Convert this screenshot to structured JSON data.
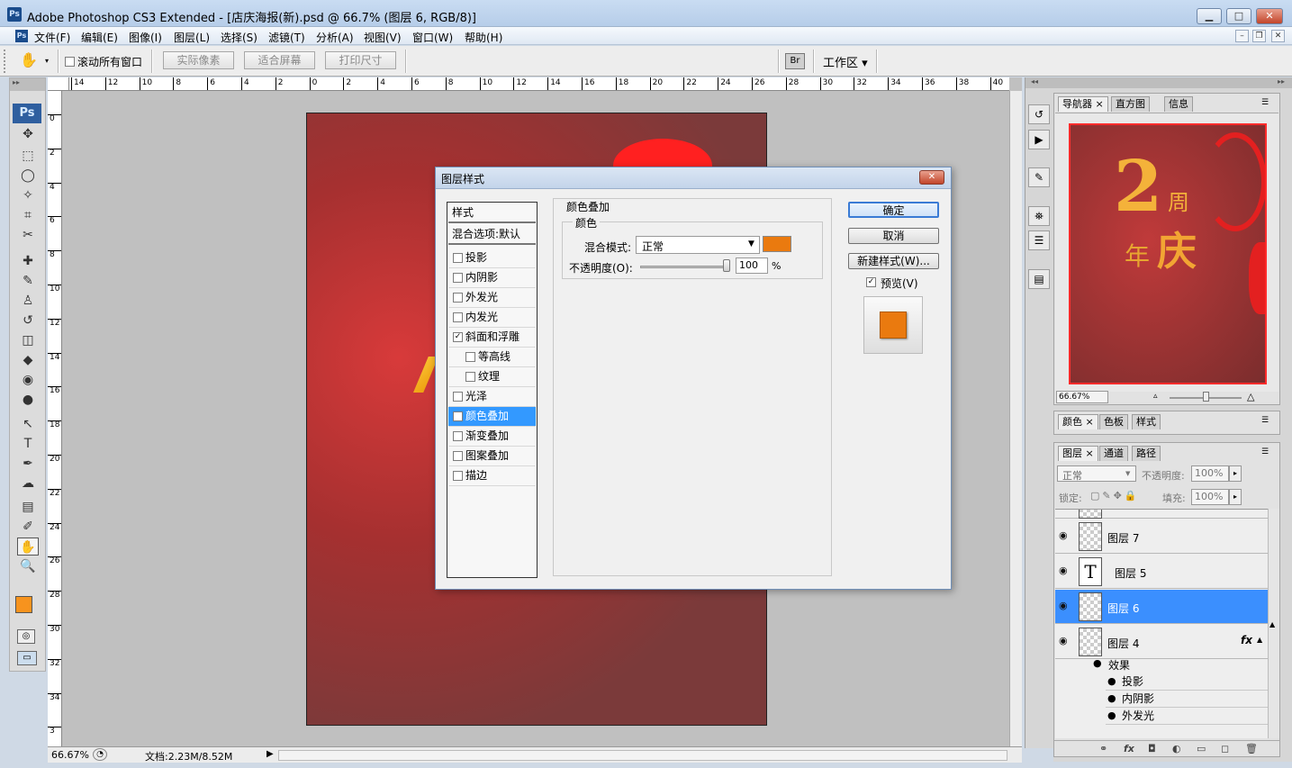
{
  "window": {
    "app_icon": "Ps",
    "title": "Adobe Photoshop CS3 Extended - [店庆海报(新).psd @ 66.7% (图层 6, RGB/8)]",
    "controls": {
      "minimize": "▁",
      "maximize": "□",
      "close": "✕"
    }
  },
  "menubar": {
    "items": [
      "文件(F)",
      "编辑(E)",
      "图像(I)",
      "图层(L)",
      "选择(S)",
      "滤镜(T)",
      "分析(A)",
      "视图(V)",
      "窗口(W)",
      "帮助(H)"
    ],
    "mdi": {
      "minimize": "–",
      "restore": "❐",
      "close": "✕"
    }
  },
  "options": {
    "tool_icon": "✋",
    "scroll_all_label": "滚动所有窗口",
    "actual_pixels": "实际像素",
    "fit_screen": "适合屏幕",
    "print_size": "打印尺寸",
    "workspace": "工作区 ▾"
  },
  "ruler": {
    "top_ticks": [
      "14",
      "12",
      "10",
      "8",
      "6",
      "4",
      "2",
      "0",
      "2",
      "4",
      "6",
      "8",
      "10",
      "12",
      "14",
      "16",
      "18",
      "20",
      "22",
      "24",
      "26",
      "28",
      "30",
      "32",
      "34",
      "36",
      "38",
      "40"
    ],
    "left_ticks": [
      "0",
      "2",
      "4",
      "6",
      "8",
      "10",
      "12",
      "14",
      "16",
      "18",
      "20",
      "22",
      "24",
      "26",
      "28",
      "30",
      "32",
      "34",
      "3"
    ]
  },
  "toolbox": {
    "logo": "Ps",
    "tools": [
      "move-tool",
      "marquee-tool",
      "lasso-tool",
      "magic-wand-tool",
      "crop-tool",
      "slice-tool",
      "healing-tool",
      "brush-tool",
      "stamp-tool",
      "history-brush-tool",
      "eraser-tool",
      "paint-bucket-tool",
      "blur-tool",
      "dodge-tool",
      "path-select-tool",
      "type-tool",
      "pen-tool",
      "shape-tool",
      "notes-tool",
      "eyedropper-tool",
      "hand-tool",
      "zoom-tool"
    ],
    "tool_glyphs": [
      "✥",
      "⬚",
      "◯",
      "✧",
      "⌗",
      "✂",
      "✚",
      "✎",
      "♙",
      "↺",
      "◫",
      "◆",
      "◉",
      "●",
      "↖",
      "T",
      "✒",
      "☁",
      "▤",
      "✐",
      "✋",
      "🔍"
    ],
    "fg_color": "#f7931e",
    "bg_color": "#ffffff"
  },
  "canvas": {
    "bg": "#8a3535"
  },
  "status": {
    "zoom": "66.67%",
    "doc": "文档:2.23M/8.52M"
  },
  "dialog": {
    "title": "图层样式",
    "close": "✕",
    "list_header": "样式",
    "blend_default": "混合选项:默认",
    "styles": [
      {
        "label": "投影",
        "checked": false,
        "indent": false,
        "selected": false
      },
      {
        "label": "内阴影",
        "checked": false,
        "indent": false,
        "selected": false
      },
      {
        "label": "外发光",
        "checked": false,
        "indent": false,
        "selected": false
      },
      {
        "label": "内发光",
        "checked": false,
        "indent": false,
        "selected": false
      },
      {
        "label": "斜面和浮雕",
        "checked": true,
        "indent": false,
        "selected": false
      },
      {
        "label": "等高线",
        "checked": false,
        "indent": true,
        "selected": false
      },
      {
        "label": "纹理",
        "checked": false,
        "indent": true,
        "selected": false
      },
      {
        "label": "光泽",
        "checked": false,
        "indent": false,
        "selected": false
      },
      {
        "label": "颜色叠加",
        "checked": true,
        "indent": false,
        "selected": true
      },
      {
        "label": "渐变叠加",
        "checked": false,
        "indent": false,
        "selected": false
      },
      {
        "label": "图案叠加",
        "checked": false,
        "indent": false,
        "selected": false
      },
      {
        "label": "描边",
        "checked": false,
        "indent": false,
        "selected": false
      }
    ],
    "section_title": "颜色叠加",
    "group_label": "颜色",
    "blend_mode_label": "混合模式:",
    "blend_mode_value": "正常",
    "overlay_color": "#ea7a0f",
    "opacity_label": "不透明度(O):",
    "opacity_value": "100",
    "opacity_fraction": 1.0,
    "percent": "%",
    "ok": "确定",
    "cancel": "取消",
    "new_style": "新建样式(W)...",
    "preview_label": "预览(V)",
    "preview_checked": true
  },
  "navigator": {
    "tabs": [
      "导航器",
      "直方图",
      "信息"
    ],
    "close": "×",
    "zoom_value": "66.67%",
    "zoom_level_fraction": 0.5,
    "thumb_text_2": "2",
    "thumb_text_zhou": "周",
    "thumb_text_nian": "年",
    "thumb_text_qing": "庆"
  },
  "color_panel": {
    "tabs": [
      "颜色",
      "色板",
      "样式"
    ],
    "close": "×"
  },
  "layers_panel": {
    "tabs": [
      "图层",
      "通道",
      "路径"
    ],
    "close": "×",
    "blend_mode": "正常",
    "opacity_label": "不透明度:",
    "opacity_value": "100%",
    "lock_label": "锁定:",
    "fill_label": "填充:",
    "fill_value": "100%",
    "eye_glyph": "👁",
    "fx_glyph": "fx",
    "layers": [
      {
        "name": "图层 7",
        "type": "raster",
        "selected": false
      },
      {
        "name": "图层 5",
        "type": "text",
        "selected": false
      },
      {
        "name": "图层 6",
        "type": "raster",
        "selected": true
      },
      {
        "name": "图层 4",
        "type": "raster",
        "selected": false
      }
    ],
    "effects_label": "效果",
    "effects": [
      "投影",
      "内阴影",
      "外发光"
    ],
    "bottom_icons": [
      "link-icon",
      "fx-icon",
      "mask-icon",
      "adjustment-icon",
      "group-icon",
      "new-layer-icon",
      "trash-icon"
    ],
    "bottom_glyphs": [
      "⚭",
      "fx",
      "◘",
      "◐",
      "▭",
      "◻",
      "🗑"
    ]
  },
  "dock": {
    "icons": [
      "history-icon",
      "actions-icon",
      "brushes-icon",
      "clone-source-icon",
      "tool-presets-icon",
      "layer-comps-icon"
    ],
    "glyphs": [
      "↺",
      "▶",
      "✎",
      "⛯",
      "☰",
      "▤"
    ],
    "expand": "◂◂",
    "collapse": "▸▸"
  }
}
